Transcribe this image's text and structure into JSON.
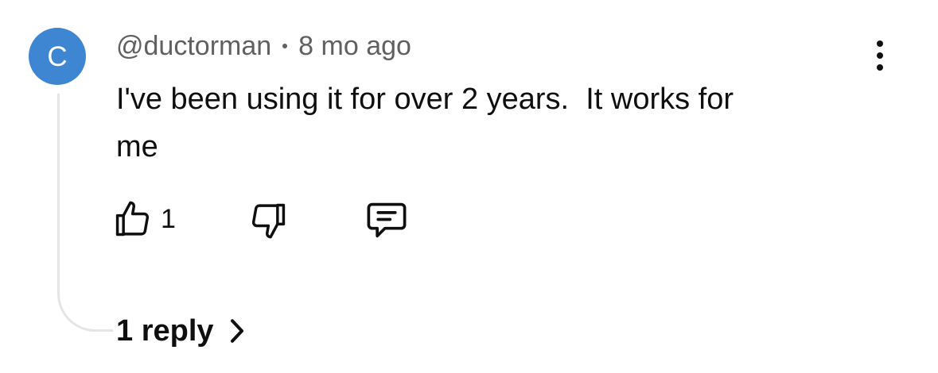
{
  "comment": {
    "avatar_letter": "C",
    "avatar_color": "#3f86d2",
    "author": "@ductorman",
    "time": "8 mo ago",
    "text_line1": "I've been using it for over 2 years.  It works for",
    "text_line2": "me"
  },
  "actions": {
    "like_icon": "thumbs-up-icon",
    "like_count": "1",
    "dislike_icon": "thumbs-down-icon",
    "reply_icon": "comment-icon"
  },
  "replies": {
    "label": "1 reply",
    "icon": "chevron-right-icon"
  },
  "menu": {
    "icon": "more-vertical-icon"
  }
}
